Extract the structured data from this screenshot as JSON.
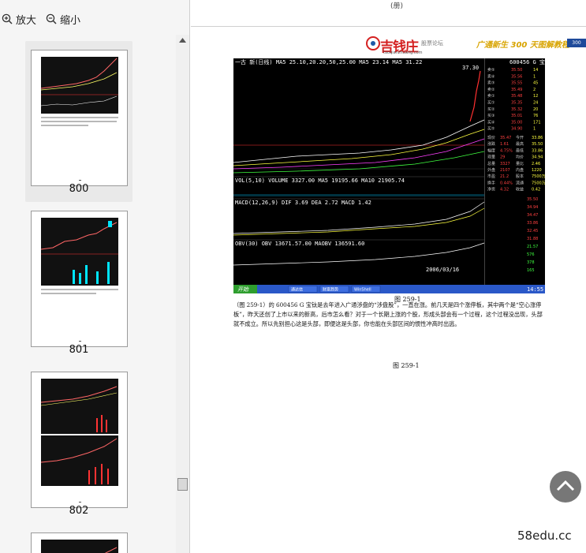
{
  "toolbar": {
    "zoom_in_label": "放大",
    "zoom_out_label": "缩小"
  },
  "thumbnails": [
    {
      "page": "800",
      "marker": "-"
    },
    {
      "page": "801",
      "marker": "-"
    },
    {
      "page": "802",
      "marker": "-"
    }
  ],
  "document": {
    "top_mark": "(册)",
    "logo_text": "吉钱庄",
    "logo_sub": "股票论坛",
    "logo_url": "taoqianzhuang.com",
    "book_title": "广通新生 300 天图解教程",
    "book_badge": "300",
    "figure_label": "图 259-1",
    "figure_label_2": "图 259-1",
    "paragraph": "（图 259-1）的 600456 G 宝钛是去年进入广通涉盘的“涉盘股”，一直在涨。前几天是四个涨停板，其中两个是“空心涨停板”，昨天还创了上市以来的新高，后市怎么看？对于一个长期上涨的个股，形成头部会有一个过程，这个过程没出现，头部就不成立。所以先别担心这是头部，即便这是头部，你也能在头部区间的惯性冲高时出逃。"
  },
  "stock": {
    "indicator_line": "一古 新(日线) MA5 25.10,20.20,50,25.00 MA5 23.14 MA5 31.22",
    "price_high": "37.30",
    "code_name": "600456 G 宝 钛",
    "vol_line": "VOL(5,10) VOLUME 3327.00 MA5 19195.66 MA10 21905.74",
    "macd_line": "MACD(12,26,9) DIF 3.69 DEA 2.72 MACD 1.42",
    "obv_line": "OBV(30) OBV 13671.57.00 MAOBV 136591.60",
    "order_rows": [
      {
        "label": "卖⑤",
        "price": "35.50",
        "vol": "14"
      },
      {
        "label": "卖④",
        "price": "35.56",
        "vol": "1"
      },
      {
        "label": "卖③",
        "price": "35.55",
        "vol": "45"
      },
      {
        "label": "卖②",
        "price": "35.49",
        "vol": "2"
      },
      {
        "label": "卖①",
        "price": "35.48",
        "vol": "12"
      },
      {
        "label": "买①",
        "price": "35.35",
        "vol": "24"
      },
      {
        "label": "买②",
        "price": "35.32",
        "vol": "20"
      },
      {
        "label": "买③",
        "price": "35.01",
        "vol": "76"
      },
      {
        "label": "买④",
        "price": "35.00",
        "vol": "171"
      },
      {
        "label": "买⑤",
        "price": "34.90",
        "vol": "1"
      }
    ],
    "stats_rows": [
      {
        "a": "现价",
        "b": "35.47",
        "c": "今开",
        "d": "33.86"
      },
      {
        "a": "涨跌",
        "b": "1.61",
        "c": "最高",
        "d": "35.50"
      },
      {
        "a": "幅度",
        "b": "4.75%",
        "c": "最低",
        "d": "33.86"
      },
      {
        "a": "现量",
        "b": "29",
        "c": "均价",
        "d": "34.94"
      },
      {
        "a": "总量",
        "b": "3327",
        "c": "量比",
        "d": "2.46"
      },
      {
        "a": "外盘",
        "b": "2107",
        "c": "内盘",
        "d": "1220"
      },
      {
        "a": "市盈",
        "b": "21.2",
        "c": "股本",
        "d": "7500万"
      },
      {
        "a": "换手",
        "b": "0.44%",
        "c": "流通",
        "d": "7500万"
      },
      {
        "a": "净资",
        "b": "4.32",
        "c": "收益",
        "d": "0.42"
      }
    ],
    "right_levels": [
      "35.50",
      "34.94",
      "34.47",
      "33.86",
      "32.45",
      "31.88",
      "21.57",
      "576",
      "378",
      "165"
    ],
    "date_label": "2006/03/16",
    "taskbar": {
      "start": "开始",
      "items": [
        "通达信",
        "财富趋势",
        "WinShell"
      ],
      "clock": "14:55"
    }
  }
}
